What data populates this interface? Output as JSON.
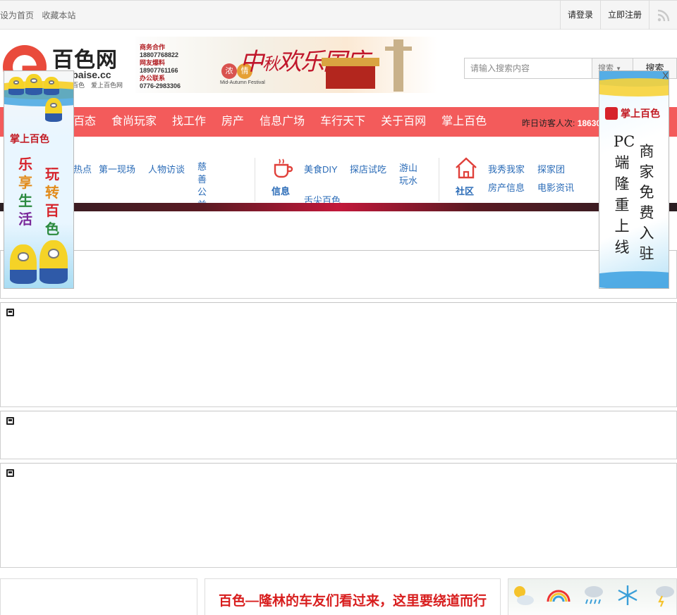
{
  "topbar": {
    "set_home": "设为首页",
    "bookmark": "收藏本站",
    "login": "请登录",
    "register": "立即注册"
  },
  "header": {
    "logo_name": "百色网",
    "logo_url": "w.baise.cc",
    "logo_slogan": "百色　爱上百色网",
    "banner": {
      "contacts": [
        {
          "key": "商务合作",
          "value": "18807768822"
        },
        {
          "key": "网友爆料",
          "value": "18907761166"
        },
        {
          "key": "办公联系",
          "value": "0776-2983306"
        }
      ],
      "chip1": "浓",
      "chip2": "情",
      "festival": "Mid-Autumn Festival",
      "headline_a": "中",
      "headline_b": "秋",
      "headline_c": "欢乐国庆"
    },
    "search": {
      "placeholder": "请输入搜索内容",
      "type": "搜索",
      "button": "搜索"
    }
  },
  "nav": {
    "items": [
      "百态",
      "食尚玩家",
      "找工作",
      "房产",
      "信息广场",
      "车行天下",
      "关于百网",
      "掌上百色"
    ],
    "visits_label": "昨日访客人次:",
    "visits_value": "18630"
  },
  "subnav": {
    "group1": [
      "热点",
      "第一现场",
      "人物访谈"
    ],
    "group1_vertical": "慈善公益",
    "group2_label": "信息",
    "group2": [
      "美食DIY",
      "探店试吃",
      "游山玩水",
      "舌尖百色"
    ],
    "group3_label": "社区",
    "group3": [
      "我秀我家",
      "探家团",
      "房产信息",
      "电影资讯"
    ]
  },
  "ad_left": {
    "title": "掌上百色",
    "chars": [
      "乐",
      "享",
      "生",
      "活",
      "玩",
      "转",
      "百",
      "色"
    ]
  },
  "ad_right": {
    "title": "掌上百色",
    "close": "X",
    "col1": "PC端隆重上线",
    "col2": "商家免费入驻"
  },
  "bottom": {
    "headline": "百色—隆林的车友们看过来，这里要绕道而行"
  },
  "colors": {
    "nav_red": "#f35b5b",
    "link_blue": "#2a6bb7",
    "headline_red": "#d81e1e"
  }
}
